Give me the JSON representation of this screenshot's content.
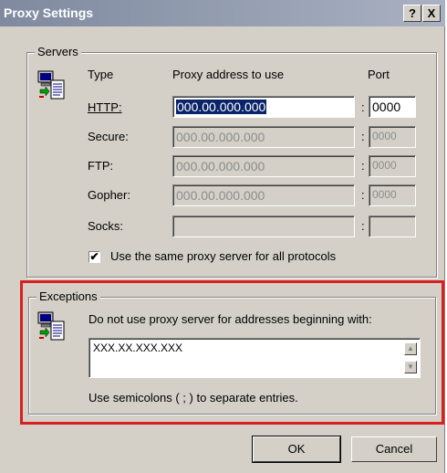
{
  "window": {
    "title": "Proxy Settings"
  },
  "titlebar_buttons": {
    "help": "?",
    "close": "X"
  },
  "servers": {
    "group_label": "Servers",
    "headers": {
      "type": "Type",
      "address": "Proxy address to use",
      "port": "Port"
    },
    "rows": [
      {
        "label": "HTTP:",
        "address": "000.00.000.000",
        "port": "0000",
        "enabled": true
      },
      {
        "label": "Secure:",
        "address": "000.00.000.000",
        "port": "0000",
        "enabled": false
      },
      {
        "label": "FTP:",
        "address": "000.00.000.000",
        "port": "0000",
        "enabled": false
      },
      {
        "label": "Gopher:",
        "address": "000.00.000.000",
        "port": "0000",
        "enabled": false
      },
      {
        "label": "Socks:",
        "address": "",
        "port": "",
        "enabled": false
      }
    ],
    "colon": ":",
    "same_proxy_checkbox": {
      "label": "Use the same proxy server for all protocols",
      "checked": true,
      "mark": "✔"
    }
  },
  "exceptions": {
    "group_label": "Exceptions",
    "instruction": "Do not use proxy server for addresses beginning with:",
    "value": "XXX.XX.XXX.XXX",
    "hint": "Use semicolons ( ; ) to separate entries."
  },
  "buttons": {
    "ok": "OK",
    "cancel": "Cancel"
  },
  "colors": {
    "highlight": "#d91f1f",
    "selection": "#0a246a"
  }
}
